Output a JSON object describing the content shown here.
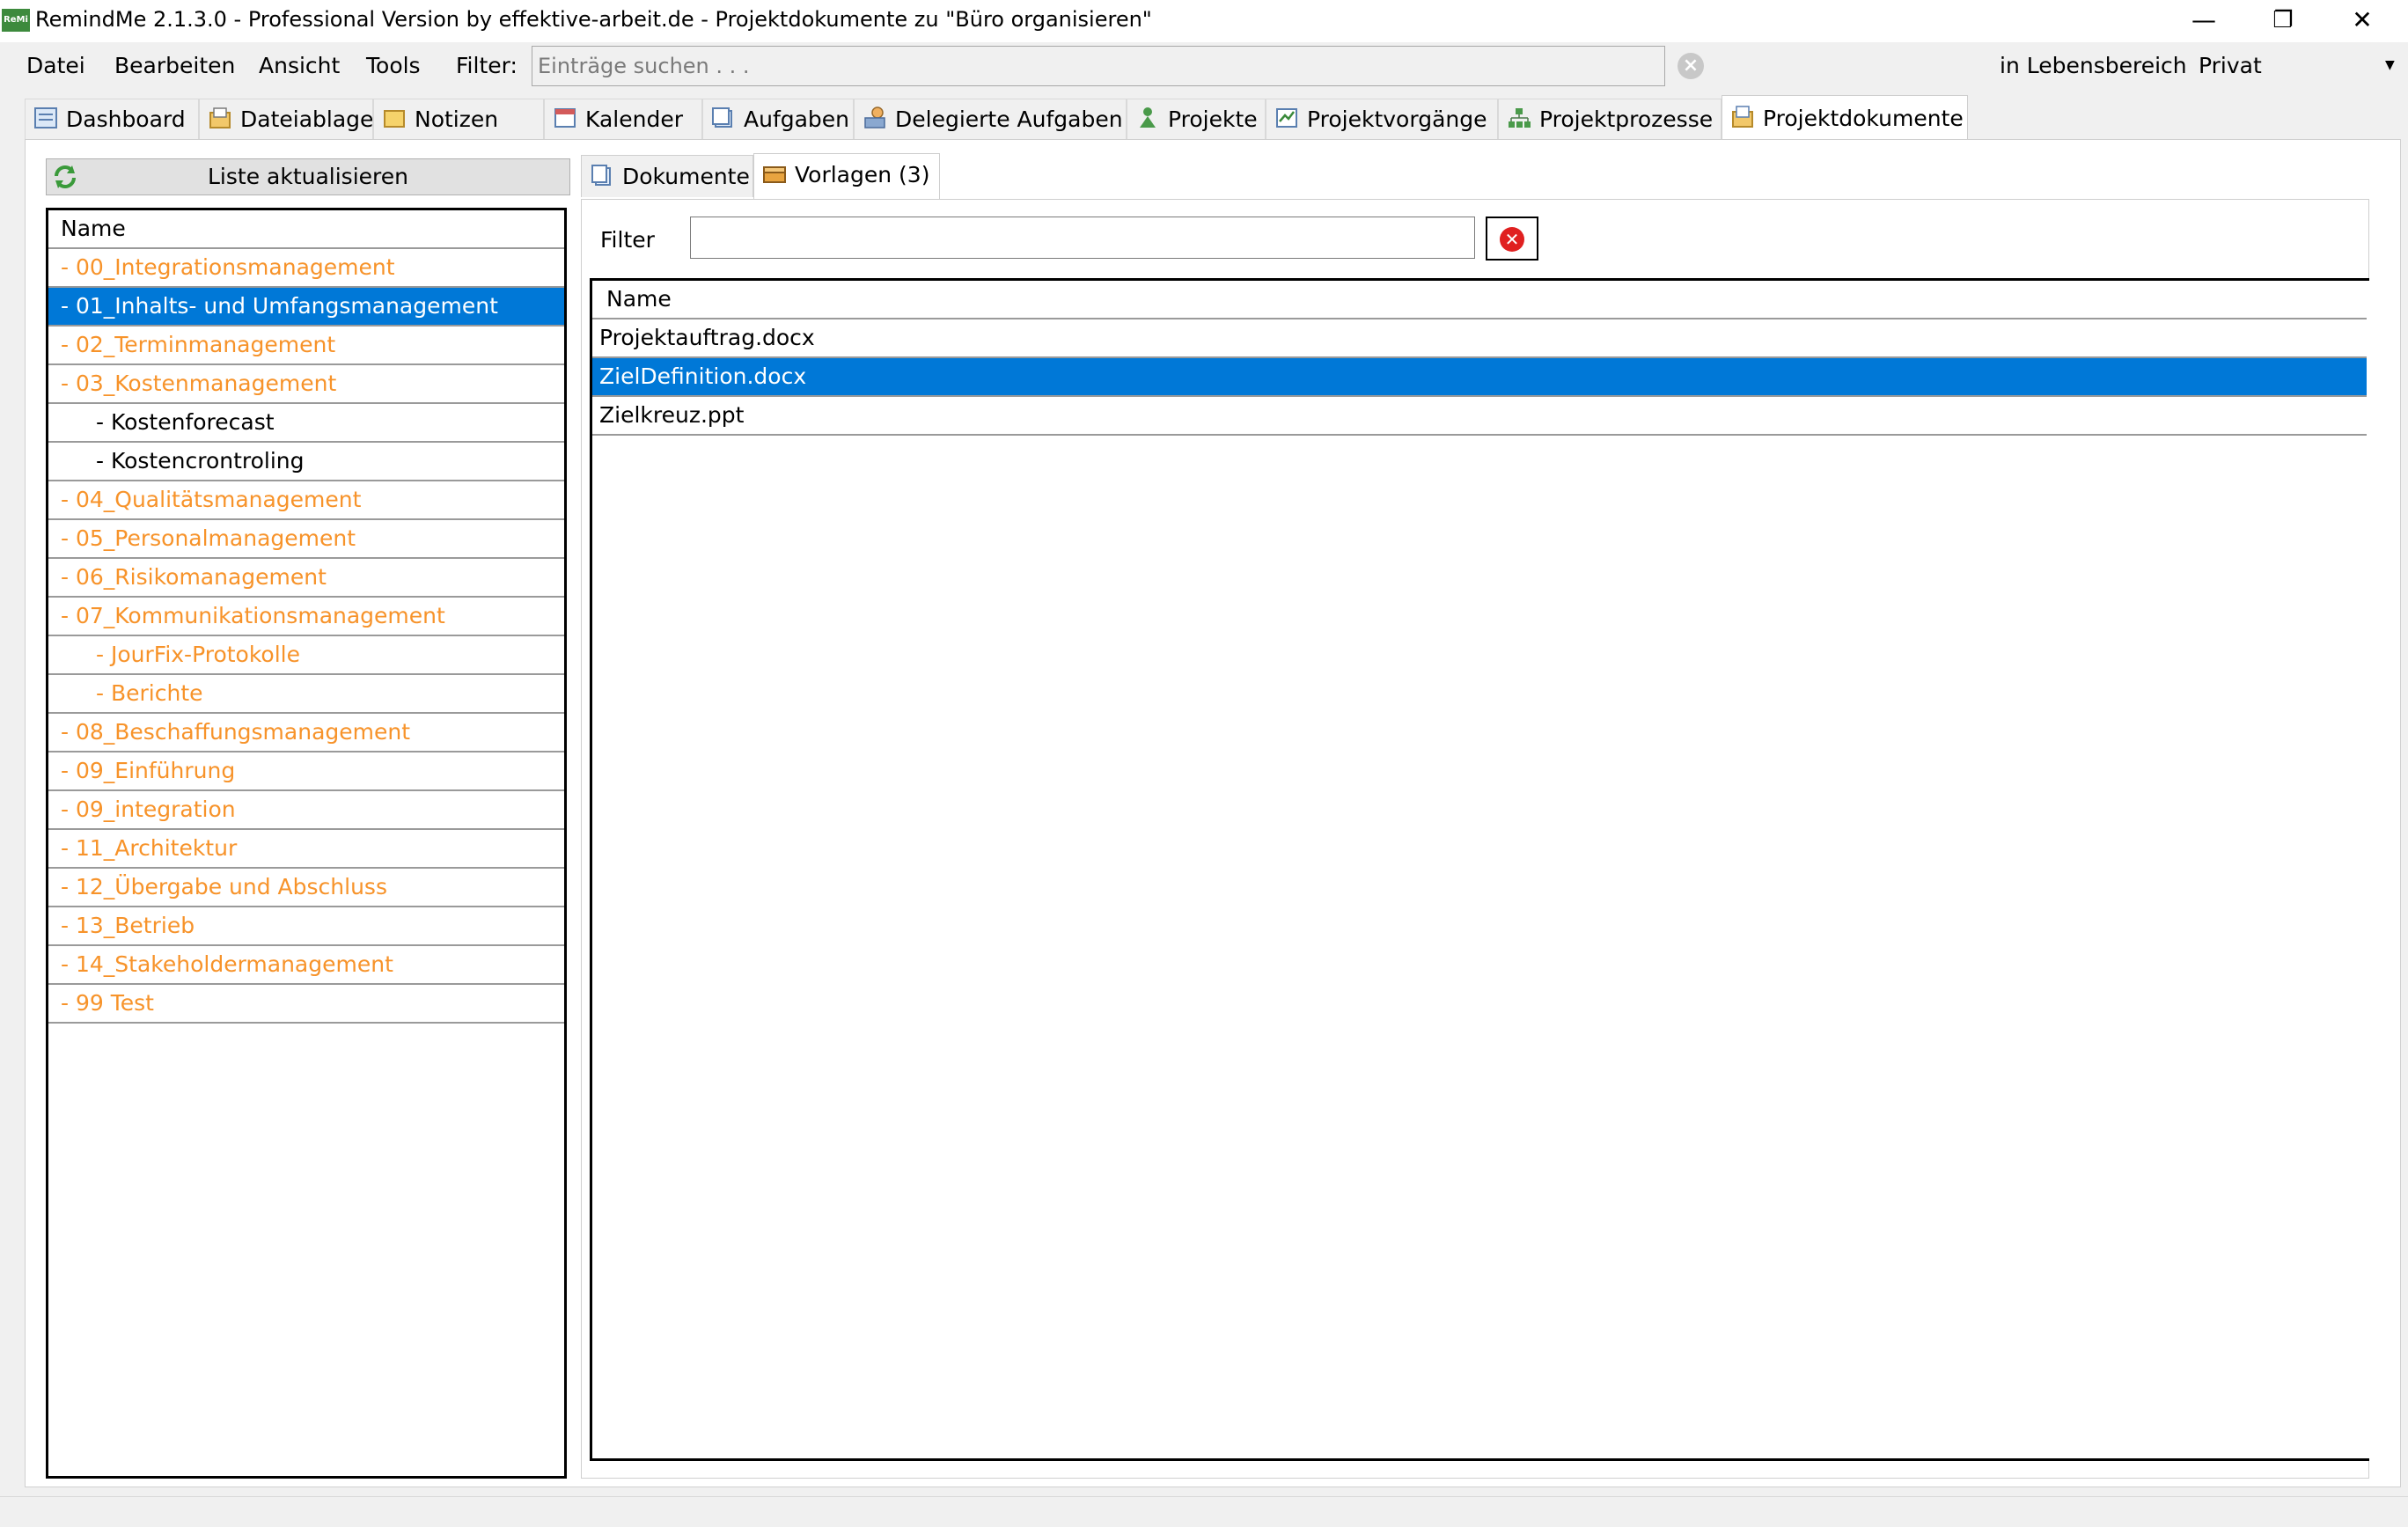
{
  "window": {
    "title": "RemindMe 2.1.3.0 - Professional Version by effektive-arbeit.de - Projektdokumente zu \"Büro organisieren\"",
    "app_icon_text": "ReMi",
    "minimize": "—",
    "restore": "❐",
    "close": "✕"
  },
  "menubar": {
    "items": [
      "Datei",
      "Bearbeiten",
      "Ansicht",
      "Tools"
    ],
    "filter_label": "Filter:",
    "search_placeholder": "Einträge suchen . . .",
    "area_label": "in Lebensbereich",
    "area_value": "Privat"
  },
  "tabs": [
    {
      "label": "Dashboard",
      "icon": "dashboard-icon"
    },
    {
      "label": "Dateiablage",
      "icon": "file-storage-icon"
    },
    {
      "label": "Notizen",
      "icon": "notes-icon"
    },
    {
      "label": "Kalender",
      "icon": "calendar-icon"
    },
    {
      "label": "Aufgaben",
      "icon": "tasks-icon"
    },
    {
      "label": "Delegierte Aufgaben",
      "icon": "delegated-tasks-icon"
    },
    {
      "label": "Projekte",
      "icon": "projects-icon"
    },
    {
      "label": "Projektvorgänge",
      "icon": "project-activities-icon"
    },
    {
      "label": "Projektprozesse",
      "icon": "project-processes-icon"
    },
    {
      "label": "Projektdokumente",
      "icon": "project-documents-icon",
      "active": true
    }
  ],
  "left": {
    "refresh_label": "Liste aktualisieren",
    "header": "Name",
    "items": [
      {
        "label": "- 00_Integrationsmanagement",
        "level": 0,
        "color": "orange"
      },
      {
        "label": "- 01_Inhalts- und Umfangsmanagement",
        "level": 0,
        "selected": true
      },
      {
        "label": "- 02_Terminmanagement",
        "level": 0,
        "color": "orange"
      },
      {
        "label": "- 03_Kostenmanagement",
        "level": 0,
        "color": "orange"
      },
      {
        "label": "- Kostenforecast",
        "level": 1,
        "color": "black"
      },
      {
        "label": "- Kostencrontroling",
        "level": 1,
        "color": "black"
      },
      {
        "label": "- 04_Qualitätsmanagement",
        "level": 0,
        "color": "orange"
      },
      {
        "label": "- 05_Personalmanagement",
        "level": 0,
        "color": "orange"
      },
      {
        "label": "- 06_Risikomanagement",
        "level": 0,
        "color": "orange"
      },
      {
        "label": "- 07_Kommunikationsmanagement",
        "level": 0,
        "color": "orange"
      },
      {
        "label": "- JourFix-Protokolle",
        "level": 1,
        "color": "orange"
      },
      {
        "label": "- Berichte",
        "level": 1,
        "color": "orange"
      },
      {
        "label": "- 08_Beschaffungsmanagement",
        "level": 0,
        "color": "orange"
      },
      {
        "label": "- 09_Einführung",
        "level": 0,
        "color": "orange"
      },
      {
        "label": "- 09_integration",
        "level": 0,
        "color": "orange"
      },
      {
        "label": "- 11_Architektur",
        "level": 0,
        "color": "orange"
      },
      {
        "label": "- 12_Übergabe und Abschluss",
        "level": 0,
        "color": "orange"
      },
      {
        "label": "- 13_Betrieb",
        "level": 0,
        "color": "orange"
      },
      {
        "label": "- 14_Stakeholdermanagement",
        "level": 0,
        "color": "orange"
      },
      {
        "label": "- 99 Test",
        "level": 0,
        "color": "orange"
      }
    ]
  },
  "right": {
    "subtabs": [
      {
        "label": "Dokumente",
        "icon": "documents-icon"
      },
      {
        "label": "Vorlagen (3)",
        "icon": "templates-icon",
        "active": true
      }
    ],
    "filter_label": "Filter",
    "filter_value": "",
    "header": "Name",
    "documents": [
      {
        "name": "Projektauftrag.docx"
      },
      {
        "name": "ZielDefinition.docx",
        "selected": true
      },
      {
        "name": "Zielkreuz.ppt"
      }
    ]
  },
  "colors": {
    "accent": "#0078d7",
    "orange": "#f7932a"
  }
}
